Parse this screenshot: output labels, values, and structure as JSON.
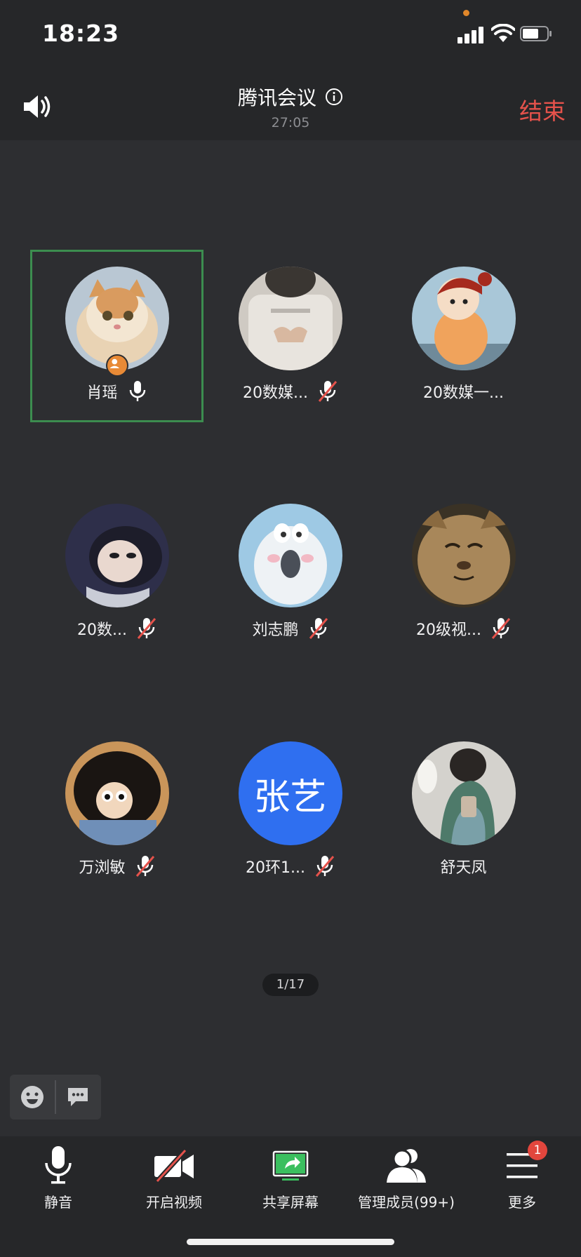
{
  "status_bar": {
    "time": "18:23"
  },
  "header": {
    "title": "腾讯会议",
    "duration": "27:05",
    "end_label": "结束"
  },
  "participants": [
    {
      "name": "肖瑶",
      "mic": "on",
      "host": true,
      "active": true,
      "avatar": "cat-photo"
    },
    {
      "name": "20数媒...",
      "mic": "muted",
      "avatar": "person-photo"
    },
    {
      "name": "20数媒一...",
      "mic": "none",
      "avatar": "cartoon-girl"
    },
    {
      "name": "20数...",
      "mic": "muted",
      "avatar": "anime-woman"
    },
    {
      "name": "刘志鹏",
      "mic": "muted",
      "avatar": "polar-bear"
    },
    {
      "name": "20级视...",
      "mic": "muted",
      "avatar": "cat-closeup"
    },
    {
      "name": "万浏敏",
      "mic": "muted",
      "avatar": "cartoon-face"
    },
    {
      "name": "20环1...",
      "mic": "muted",
      "avatar_text": "张艺",
      "avatar_color": "#2f6ff0"
    },
    {
      "name": "舒天凤",
      "mic": "none",
      "avatar": "person-on-plane"
    }
  ],
  "page_indicator": "1/17",
  "toolbar": {
    "mute_label": "静音",
    "video_label": "开启视频",
    "share_label": "共享屏幕",
    "members_label": "管理成员(99+)",
    "more_label": "更多",
    "more_badge": "1"
  },
  "colors": {
    "accent_end": "#e5524b",
    "active_border": "#3c8d4f",
    "share_green": "#3bbf5f",
    "badge_red": "#e2463d"
  }
}
